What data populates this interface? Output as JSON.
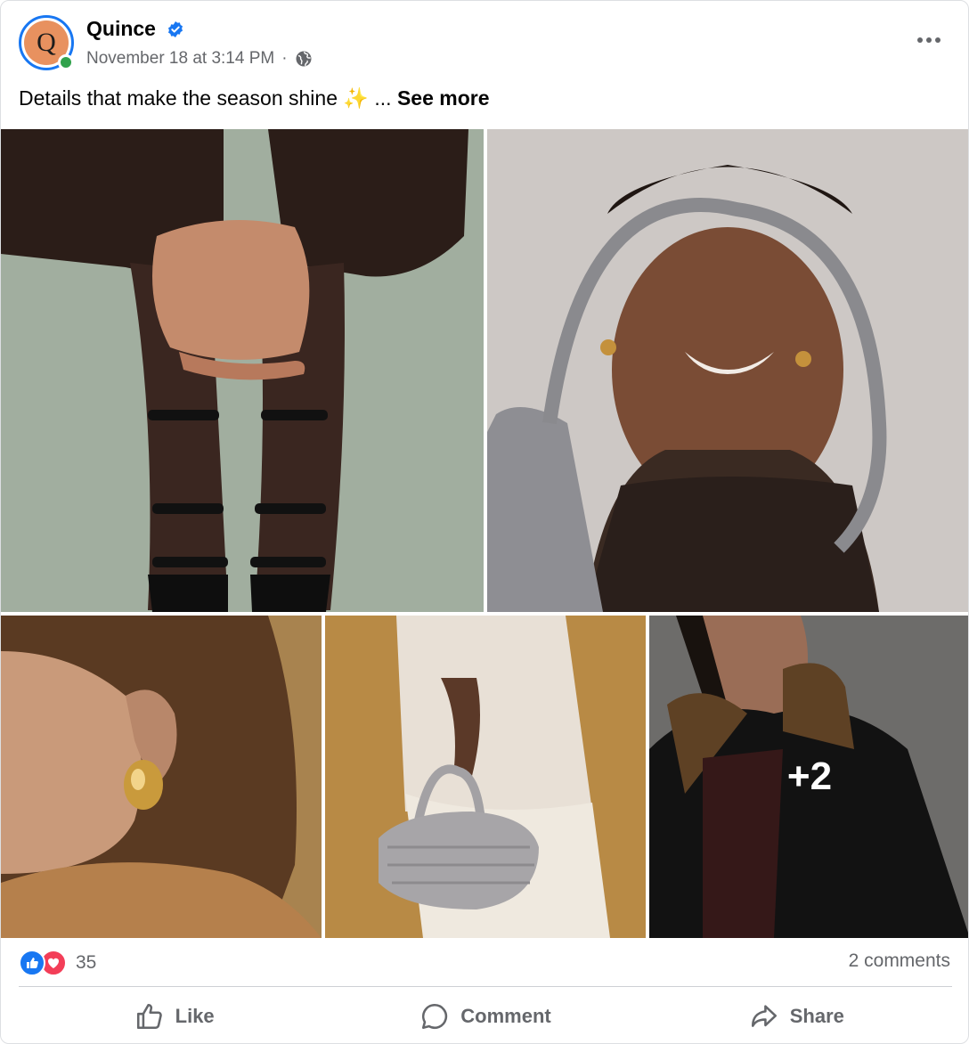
{
  "post": {
    "author": {
      "name": "Quince",
      "avatar_letter": "Q",
      "verified": true
    },
    "timestamp": "November 18 at 3:14 PM",
    "separator": "·",
    "privacy_icon": "globe-icon",
    "caption": {
      "text": "Details that make the season shine ✨ ...",
      "see_more": "See more"
    },
    "photos": [
      {
        "name": "photo-hands-rings"
      },
      {
        "name": "photo-smiling-woman-bag"
      },
      {
        "name": "photo-gold-earring"
      },
      {
        "name": "photo-woven-handbag"
      },
      {
        "name": "photo-man-leather-jacket"
      }
    ],
    "more_photos_label": "+2",
    "reactions": {
      "types": [
        "like",
        "love"
      ],
      "count": "35"
    },
    "comments_label": "2 comments",
    "actions": {
      "like": "Like",
      "comment": "Comment",
      "share": "Share"
    }
  },
  "colors": {
    "brand_blue": "#1877f2",
    "love_red": "#f33e58",
    "secondary_text": "#65676b",
    "avatar_orange": "#e8915f",
    "online_green": "#31a24c"
  }
}
